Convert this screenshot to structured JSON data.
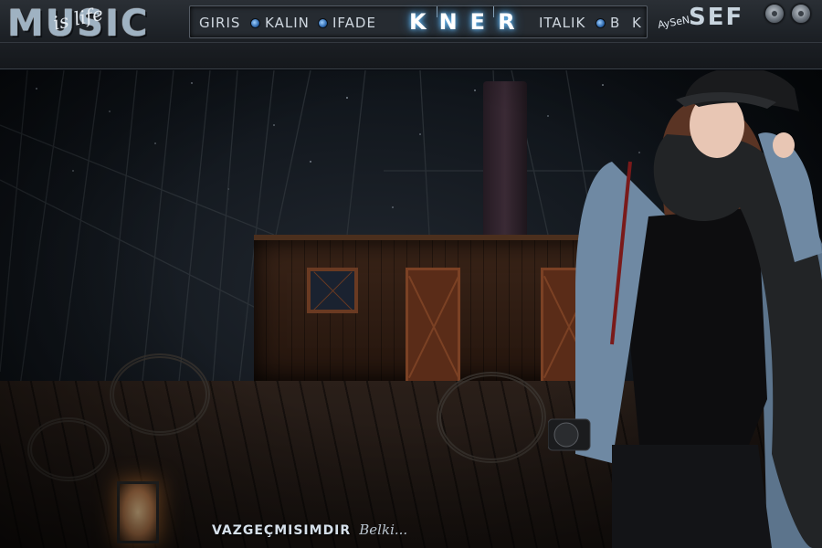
{
  "logo": {
    "main": "MUSIC",
    "sub": "is life"
  },
  "menu": {
    "items": [
      {
        "label": "GIRIS"
      },
      {
        "label": "KALIN"
      },
      {
        "label": "IFADE"
      },
      {
        "label": "ITALIK"
      },
      {
        "label": "B"
      },
      {
        "label": "K"
      }
    ],
    "brand": "KNER"
  },
  "badge": {
    "small": "AySeN",
    "big": "SEF"
  },
  "caption": {
    "main": "VAZGEÇMISIMDIR",
    "signature": "Belki..."
  },
  "icons": {
    "menu_dot": "dot-icon",
    "window_buttons": [
      "circle-button-icon",
      "circle-button-icon"
    ]
  },
  "colors": {
    "accent": "#6fc3ff",
    "dot": "#2f6ab0",
    "bar": "#262b31"
  }
}
